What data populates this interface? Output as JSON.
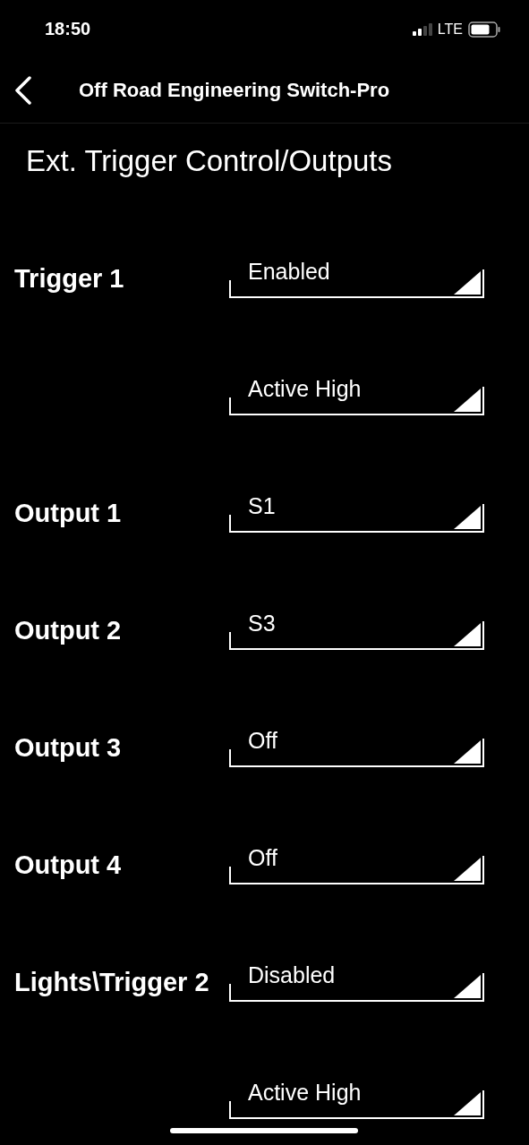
{
  "status_bar": {
    "time": "18:50",
    "network": "LTE"
  },
  "nav": {
    "title": "Off Road Engineering Switch-Pro"
  },
  "heading": "Ext. Trigger Control/Outputs",
  "rows": [
    {
      "label": "Trigger 1",
      "value": "Enabled"
    },
    {
      "value": "Active High"
    },
    {
      "label": "Output 1",
      "value": "S1"
    },
    {
      "label": "Output 2",
      "value": "S3"
    },
    {
      "label": "Output 3",
      "value": "Off"
    },
    {
      "label": "Output 4",
      "value": "Off"
    },
    {
      "label": "Lights\\Trigger 2",
      "value": "Disabled"
    },
    {
      "value": "Active High"
    }
  ]
}
